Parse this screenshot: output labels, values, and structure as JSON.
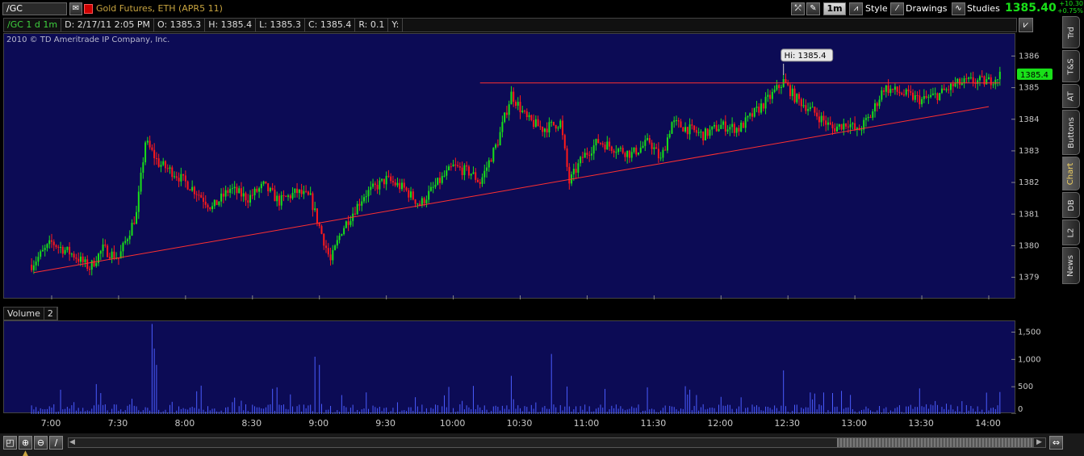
{
  "toolbar": {
    "symbol": "/GC",
    "title": "Gold Futures, ETH (APR5 11)",
    "interval": "1m",
    "style_label": "Style",
    "drawings_label": "Drawings",
    "studies_label": "Studies",
    "last_price": "1385.40",
    "net_change": "+10.30",
    "pct_change": "+0.75%"
  },
  "infobar": {
    "symbol": "/GC 1 d 1m",
    "date": "D: 2/17/11 2:05 PM",
    "open": "O: 1385.3",
    "high": "H: 1385.4",
    "low": "L: 1385.3",
    "close": "C: 1385.4",
    "range": "R: 0.1",
    "y": "Y:"
  },
  "copyright": "2010 © TD Ameritrade IP Company, Inc.",
  "volume_header": {
    "label": "Volume",
    "value": "2"
  },
  "sidebar": {
    "tabs": [
      "Trd",
      "T&S",
      "AT",
      "Buttons",
      "Chart",
      "DB",
      "L2",
      "News"
    ],
    "active": "Chart"
  },
  "colors": {
    "panel_bg": "#0c0b55",
    "up": "#19e019",
    "down": "#ff1a1a",
    "trendline": "#ff3030",
    "volume": "#4a5cff",
    "axis_text": "#c8c8c8"
  },
  "chart_data": [
    {
      "type": "candlestick",
      "title": "",
      "ylim": [
        1378.3,
        1386.7
      ],
      "y_ticks": [
        1379,
        1380,
        1381,
        1382,
        1383,
        1384,
        1385,
        1386
      ],
      "x_ticks": [
        "7:00",
        "7:30",
        "8:00",
        "8:30",
        "9:00",
        "9:30",
        "10:00",
        "10:30",
        "11:00",
        "11:30",
        "12:00",
        "12:30",
        "13:00",
        "13:30",
        "14:00"
      ],
      "last_price_label": "1385.4",
      "annotation": "Hi: 1385.4",
      "path": [
        [
          "6:51",
          1379.4
        ],
        [
          "7:00",
          1380.1
        ],
        [
          "7:10",
          1379.7
        ],
        [
          "7:17",
          1379.3
        ],
        [
          "7:23",
          1379.9
        ],
        [
          "7:30",
          1379.6
        ],
        [
          "7:38",
          1381.0
        ],
        [
          "7:42",
          1383.3
        ],
        [
          "7:48",
          1382.6
        ],
        [
          "7:55",
          1382.3
        ],
        [
          "8:05",
          1381.7
        ],
        [
          "8:12",
          1381.2
        ],
        [
          "8:20",
          1381.8
        ],
        [
          "8:28",
          1381.5
        ],
        [
          "8:35",
          1381.9
        ],
        [
          "8:42",
          1381.4
        ],
        [
          "8:50",
          1381.7
        ],
        [
          "8:56",
          1381.5
        ],
        [
          "9:00",
          1380.6
        ],
        [
          "9:05",
          1379.5
        ],
        [
          "9:10",
          1380.5
        ],
        [
          "9:20",
          1381.6
        ],
        [
          "9:30",
          1382.1
        ],
        [
          "9:38",
          1381.8
        ],
        [
          "9:45",
          1381.3
        ],
        [
          "9:52",
          1381.9
        ],
        [
          "10:00",
          1382.5
        ],
        [
          "10:08",
          1382.3
        ],
        [
          "10:12",
          1382.0
        ],
        [
          "10:20",
          1383.3
        ],
        [
          "10:26",
          1384.8
        ],
        [
          "10:33",
          1384.0
        ],
        [
          "10:40",
          1383.7
        ],
        [
          "10:48",
          1383.9
        ],
        [
          "10:52",
          1382.0
        ],
        [
          "10:58",
          1382.8
        ],
        [
          "11:05",
          1383.3
        ],
        [
          "11:12",
          1383.1
        ],
        [
          "11:20",
          1382.9
        ],
        [
          "11:28",
          1383.3
        ],
        [
          "11:33",
          1382.7
        ],
        [
          "11:38",
          1383.9
        ],
        [
          "11:45",
          1383.7
        ],
        [
          "11:52",
          1383.5
        ],
        [
          "12:00",
          1383.8
        ],
        [
          "12:08",
          1383.7
        ],
        [
          "12:15",
          1384.2
        ],
        [
          "12:22",
          1384.7
        ],
        [
          "12:28",
          1385.2
        ],
        [
          "12:33",
          1384.7
        ],
        [
          "12:42",
          1384.2
        ],
        [
          "12:50",
          1383.7
        ],
        [
          "12:57",
          1383.9
        ],
        [
          "13:01",
          1383.6
        ],
        [
          "13:07",
          1384.1
        ],
        [
          "13:13",
          1385.0
        ],
        [
          "13:22",
          1384.8
        ],
        [
          "13:30",
          1384.6
        ],
        [
          "13:38",
          1384.8
        ],
        [
          "13:45",
          1385.1
        ],
        [
          "13:52",
          1385.2
        ],
        [
          "14:00",
          1385.2
        ],
        [
          "14:05",
          1385.4
        ]
      ],
      "lines": [
        {
          "name": "resistance",
          "from": [
            "10:12",
            1385.15
          ],
          "to": [
            "14:05",
            1385.15
          ]
        },
        {
          "name": "support",
          "from": [
            "6:52",
            1379.15
          ],
          "to": [
            "14:00",
            1384.4
          ]
        }
      ]
    },
    {
      "type": "bar",
      "title": "Volume",
      "ylim": [
        0,
        1700
      ],
      "y_ticks": [
        "0",
        "500",
        "1,000",
        "1,500"
      ],
      "spikes": [
        [
          "7:45",
          1650
        ],
        [
          "7:46",
          1200
        ],
        [
          "7:47",
          900
        ],
        [
          "8:58",
          1050
        ],
        [
          "9:00",
          900
        ],
        [
          "10:44",
          1100
        ],
        [
          "10:26",
          700
        ],
        [
          "12:28",
          800
        ]
      ]
    }
  ]
}
